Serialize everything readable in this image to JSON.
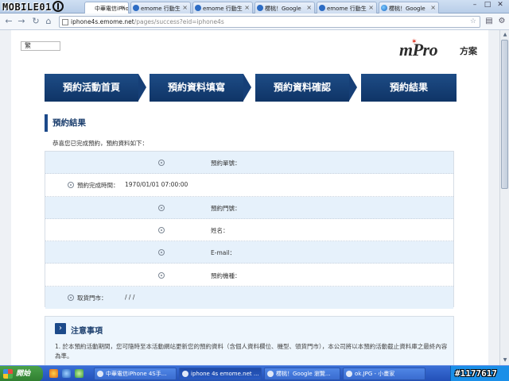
{
  "watermark_left": "MOBILE01",
  "watermark_right": "#1177617",
  "tabs": [
    {
      "title": "中華電信iPhon"
    },
    {
      "title": "emome 行動生"
    },
    {
      "title": "emome 行動生"
    },
    {
      "title": "櫻桃！Google"
    },
    {
      "title": "emome 行動生"
    },
    {
      "title": "櫻桃！Google"
    }
  ],
  "window_controls": {
    "minimize": "–",
    "maximize": "□",
    "close": "✕"
  },
  "address_bar": {
    "host": "iphone4s.emome.net",
    "path": "/pages/success?eid=iphone4s"
  },
  "page": {
    "lang_selector": "繁",
    "logo": {
      "mark": "mPro",
      "suffix": "方案"
    },
    "steps": [
      "預約活動首頁",
      "預約資料填寫",
      "預約資料確認",
      "預約結果"
    ],
    "section_title": "預約結果",
    "intro": "恭喜您已完成預約，預約資料如下：",
    "rows": [
      {
        "label": "預約單號：",
        "value": ""
      },
      {
        "label": "預約完成時間：",
        "value": "1970/01/01 07:00:00"
      },
      {
        "label": "預約門號：",
        "value": ""
      },
      {
        "label": "姓名：",
        "value": ""
      },
      {
        "label": "E-mail：",
        "value": ""
      },
      {
        "label": "預約機種：",
        "value": ""
      },
      {
        "label": "取貨門市：",
        "value": "/ / /"
      }
    ],
    "notes": {
      "title": "注意事項",
      "items": [
        "1. 於本預約活動期間，您可隨時至本活動網站更新您的預約資料（含個人資料欄位、機型、領貨門市），本公司將以本預約活動截止資料庫之最終內容為準。"
      ]
    }
  },
  "taskbar": {
    "start": "開始",
    "tasks": [
      "中華電信iPhone 4S手...",
      "iphone 4s emome.net ...",
      "櫻桃！Google 瀏覽...",
      "ok.JPG - 小畫家"
    ]
  }
}
